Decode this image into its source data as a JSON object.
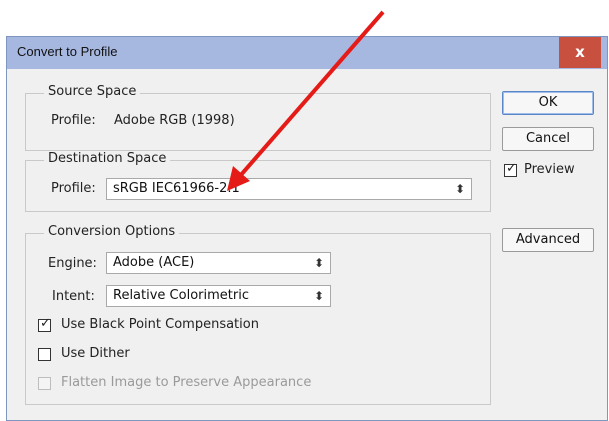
{
  "dialog": {
    "title": "Convert to Profile",
    "close_label": "x"
  },
  "source_space": {
    "legend": "Source Space",
    "profile_label": "Profile:",
    "profile_value": "Adobe RGB (1998)"
  },
  "destination_space": {
    "legend": "Destination Space",
    "profile_label": "Profile:",
    "profile_selected": "sRGB IEC61966-2.1"
  },
  "conversion_options": {
    "legend": "Conversion Options",
    "engine_label": "Engine:",
    "engine_selected": "Adobe (ACE)",
    "intent_label": "Intent:",
    "intent_selected": "Relative Colorimetric",
    "black_point_label": "Use Black Point Compensation",
    "black_point_checked": true,
    "dither_label": "Use Dither",
    "dither_checked": false,
    "flatten_label": "Flatten Image to Preserve Appearance",
    "flatten_checked": false,
    "flatten_enabled": false
  },
  "buttons": {
    "ok": "OK",
    "cancel": "Cancel",
    "advanced": "Advanced"
  },
  "preview": {
    "label": "Preview",
    "checked": true
  },
  "colors": {
    "annotation_arrow": "#e41b17",
    "titlebar": "#a6b7e0",
    "close_button": "#c7503f"
  }
}
